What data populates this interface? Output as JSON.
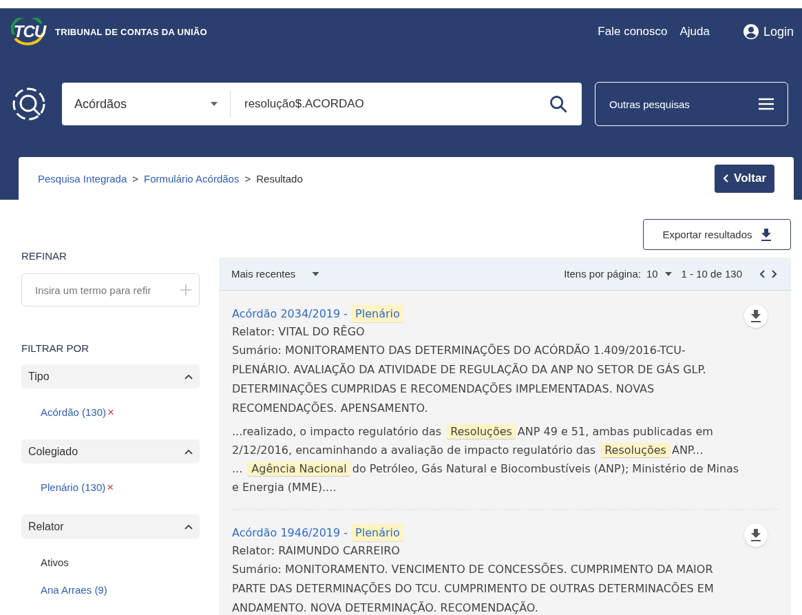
{
  "header": {
    "logo": "TCU",
    "org_name": "TRIBUNAL DE CONTAS DA UNIÃO",
    "links": [
      "Fale conosco",
      "Ajuda"
    ],
    "login": "Login"
  },
  "search": {
    "scope": "Acórdãos",
    "query": "resolução$.ACORDAO",
    "other_searches": "Outras pesquisas"
  },
  "breadcrumb": {
    "items": [
      "Pesquisa Integrada",
      "Formulário Acórdãos",
      "Resultado"
    ],
    "separator": ">",
    "back": "Voltar"
  },
  "export": "Exportar resultados",
  "sidebar": {
    "refine_title": "REFINAR",
    "refine_placeholder": "Insira um termo para refir",
    "filter_title": "FILTRAR POR",
    "groups": [
      {
        "title": "Tipo",
        "expanded": true,
        "items": [
          {
            "kind": "active",
            "label": "Acórdão (130)",
            "remove": "×"
          }
        ]
      },
      {
        "title": "Colegiado",
        "expanded": true,
        "items": [
          {
            "kind": "active",
            "label": "Plenário (130)",
            "remove": "×"
          }
        ]
      },
      {
        "title": "Relator",
        "expanded": true,
        "items": [
          {
            "kind": "heading",
            "label": "Ativos"
          },
          {
            "kind": "option",
            "label": "Ana Arraes (9)"
          }
        ]
      }
    ]
  },
  "toolbar": {
    "sort": "Mais recentes",
    "per_page_label": "Itens por página:",
    "per_page": "10",
    "range": "1 - 10 de 130"
  },
  "results": [
    {
      "title": "Acórdão 2034/2019 -",
      "colegiado": "Plenário",
      "relator": "Relator: VITAL DO RÊGO",
      "summary": "Sumário: MONITORAMENTO DAS DETERMINAÇÕES DO ACÓRDÃO 1.409/2016-TCU-PLENÁRIO. AVALIAÇÃO DA ATIVIDADE DE REGULAÇÃO DA ANP NO SETOR DE GÁS GLP. DETERMINAÇÕES CUMPRIDAS E RECOMENDAÇÕES IMPLEMENTADAS. NOVAS RECOMENDAÇÕES. APENSAMENTO.",
      "excerpts": [
        {
          "segments": [
            {
              "text": "...realizado, o impacto regulatório das",
              "highlight": false
            },
            {
              "text": "Resoluções",
              "highlight": true
            },
            {
              "text": "ANP 49 e 51, ambas publicadas em 2/12/2016, encaminhando a avaliação de impacto regulatório das",
              "highlight": false
            },
            {
              "text": "Resoluções",
              "highlight": true
            },
            {
              "text": "ANP...",
              "highlight": false
            }
          ]
        },
        {
          "segments": [
            {
              "text": "...",
              "highlight": false
            },
            {
              "text": "Agência Nacional",
              "highlight": true
            },
            {
              "text": "do Petróleo, Gás Natural e Biocombustíveis (ANP); Ministério de Minas e Energia (MME)....",
              "highlight": false
            }
          ]
        }
      ]
    },
    {
      "title": "Acórdão 1946/2019 -",
      "colegiado": "Plenário",
      "relator": "Relator: RAIMUNDO CARREIRO",
      "summary": "Sumário: MONITORAMENTO. VENCIMENTO DE CONCESSÕES. CUMPRIMENTO DA MAIOR PARTE DAS DETERMINAÇÕES DO TCU. CUMPRIMENTO DE OUTRAS DETERMINACÕES EM ANDAMENTO. NOVA DETERMINAÇÃO. RECOMENDAÇÃO."
    }
  ]
}
